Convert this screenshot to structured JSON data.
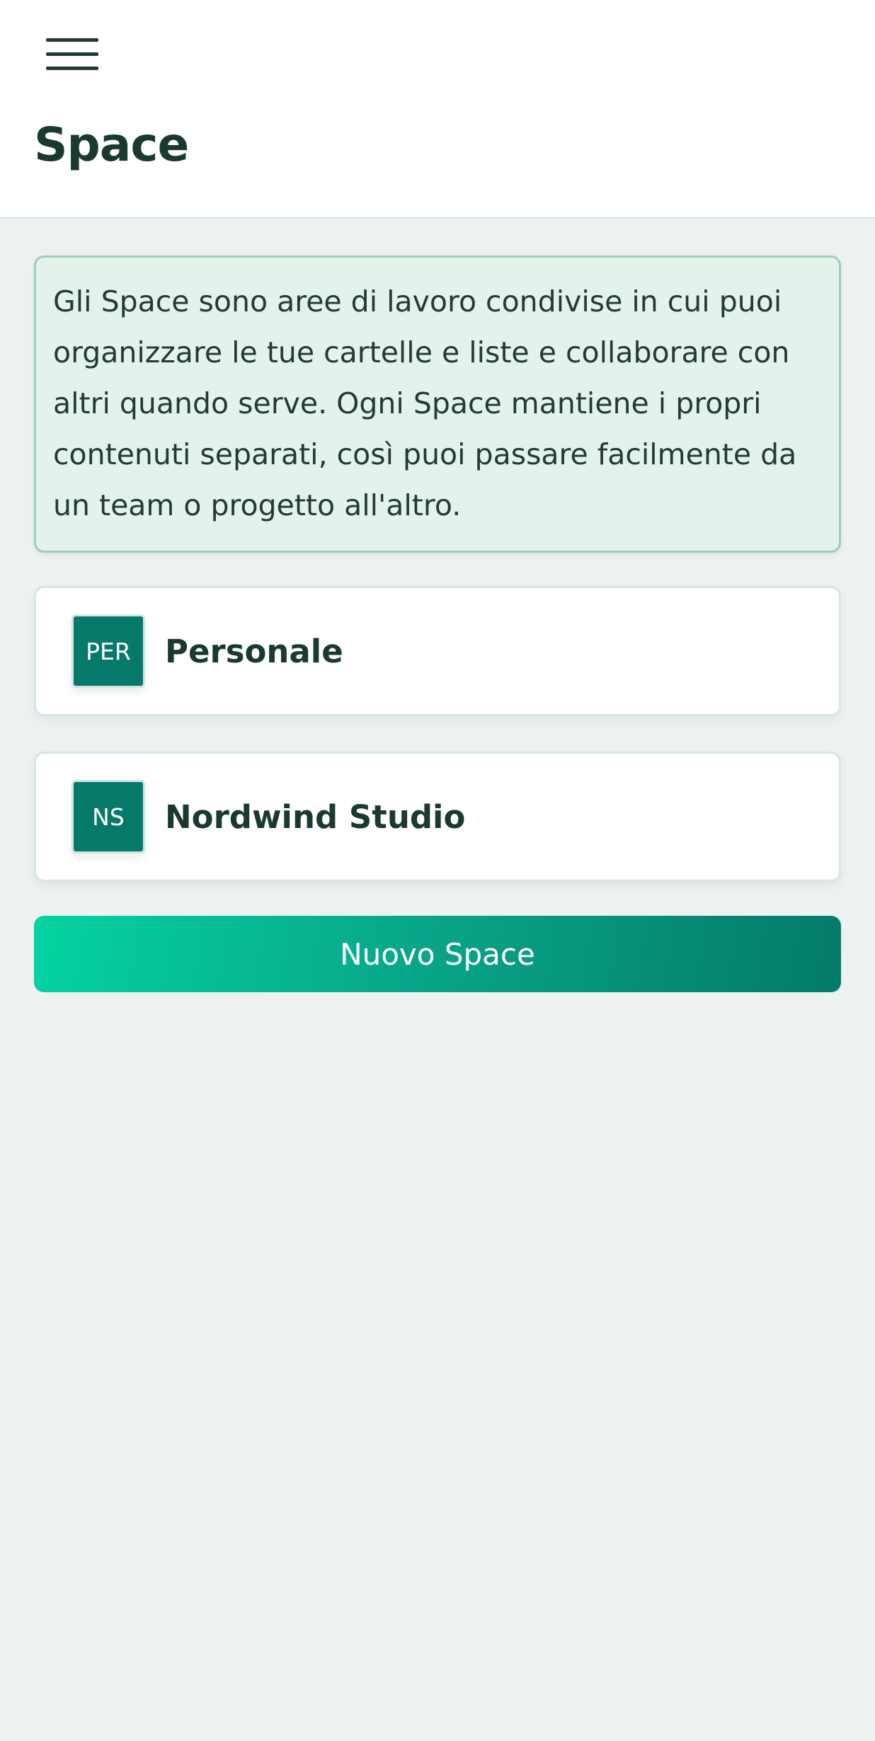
{
  "header": {
    "title": "Space",
    "menu_icon": "hamburger-menu-icon"
  },
  "info": {
    "text": "Gli Space sono aree di lavoro condivise in cui puoi organizzare le tue cartelle e liste e collaborare con altri quando serve. Ogni Space mantiene i propri contenuti separati, così puoi passare facilmente da un team o progetto all'altro."
  },
  "spaces": [
    {
      "initials": "PER",
      "name": "Personale"
    },
    {
      "initials": "NS",
      "name": "Nordwind Studio"
    }
  ],
  "actions": {
    "new_space_label": "Nuovo Space"
  },
  "colors": {
    "accent": "#07796a",
    "gradient_start": "#04d3a1",
    "gradient_end": "#047a69",
    "info_background": "#e4f2ec",
    "page_background": "#edf1f0"
  }
}
